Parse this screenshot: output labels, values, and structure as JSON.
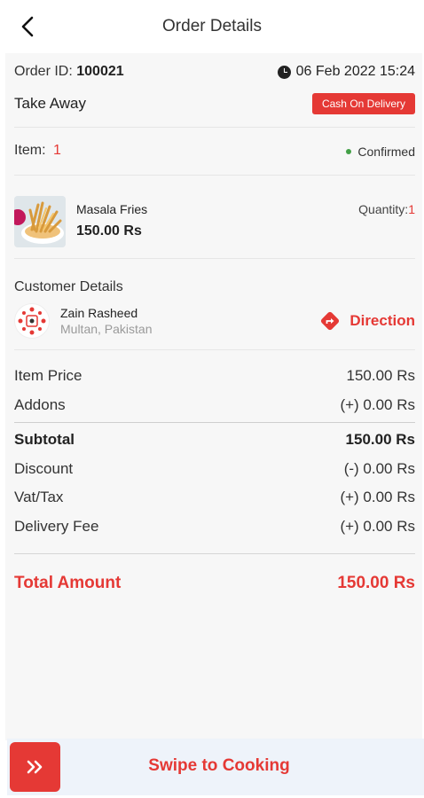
{
  "header": {
    "title": "Order Details",
    "back_icon": "chevron-left-icon"
  },
  "order": {
    "id_label": "Order ID:",
    "id_value": "100021",
    "datetime": "06 Feb 2022  15:24",
    "type": "Take Away",
    "payment": "Cash On Delivery"
  },
  "items": {
    "label": "Item:",
    "count": "1",
    "status": "Confirmed",
    "status_color": "#43a047",
    "product": {
      "name": "Masala Fries",
      "price": "150.00 Rs",
      "qty_label": "Quantity:",
      "qty_value": "1"
    }
  },
  "customer": {
    "title": "Customer Details",
    "name": "Zain Rasheed",
    "location": "Multan, Pakistan",
    "direction_label": "Direction"
  },
  "fees": {
    "item_price_label": "Item Price",
    "item_price": "150.00 Rs",
    "addons_label": "Addons",
    "addons": "(+) 0.00 Rs",
    "subtotal_label": "Subtotal",
    "subtotal": "150.00 Rs",
    "discount_label": "Discount",
    "discount": "(-) 0.00 Rs",
    "vat_label": "Vat/Tax",
    "vat": "(+) 0.00 Rs",
    "delivery_label": "Delivery Fee",
    "delivery": "(+) 0.00 Rs",
    "total_label": "Total Amount",
    "total": "150.00 Rs"
  },
  "swipe": {
    "label": "Swipe to Cooking",
    "icon": "double-chevron-right-icon"
  },
  "colors": {
    "accent": "#e53935",
    "background": "#f7f7f7"
  }
}
